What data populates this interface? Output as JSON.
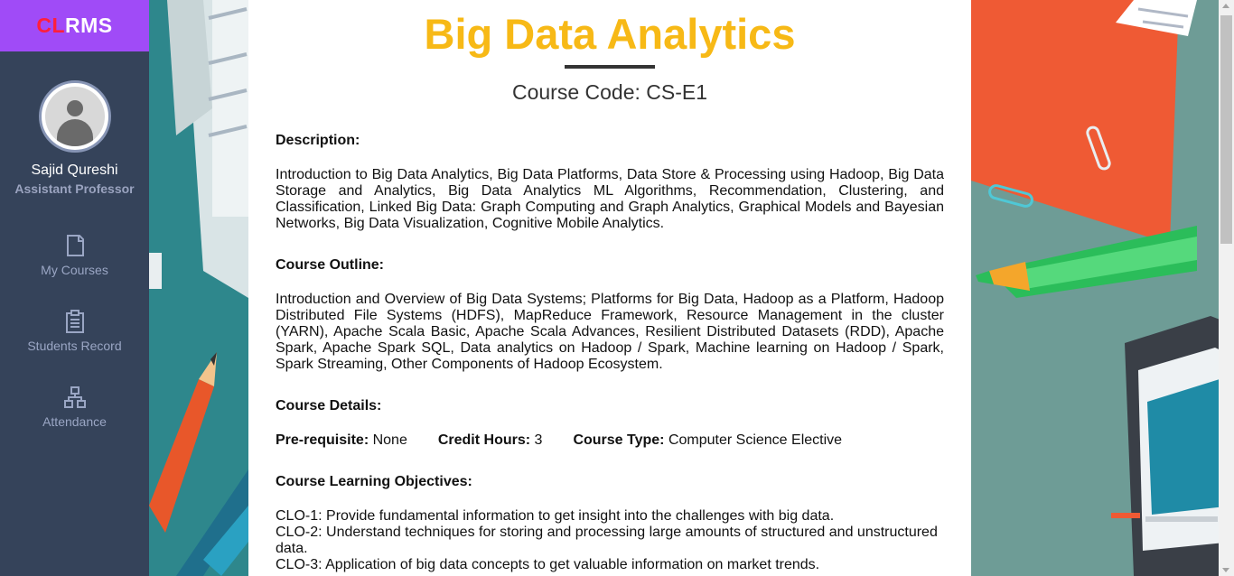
{
  "brand": {
    "part1": "CL",
    "part2": "RMS"
  },
  "user": {
    "name": "Sajid Qureshi",
    "role": "Assistant Professor"
  },
  "nav": [
    {
      "label": "My Courses",
      "icon": "document-icon"
    },
    {
      "label": "Students Record",
      "icon": "clipboard-icon"
    },
    {
      "label": "Attendance",
      "icon": "hierarchy-icon"
    }
  ],
  "course": {
    "title": "Big Data Analytics",
    "code_label": "Course Code:",
    "code": "CS-E1",
    "description_heading": "Description:",
    "description": "Introduction to Big Data Analytics, Big Data Platforms, Data Store & Processing using Hadoop, Big Data Storage and Analytics, Big Data Analytics ML Algorithms, Recommendation, Clustering, and Classification, Linked Big Data: Graph Computing and Graph Analytics, Graphical Models and Bayesian Networks, Big Data Visualization, Cognitive Mobile Analytics.",
    "outline_heading": "Course Outline:",
    "outline": "Introduction and Overview of Big Data Systems; Platforms for Big Data, Hadoop as a Platform, Hadoop Distributed File Systems (HDFS), MapReduce Framework, Resource Management in the cluster (YARN), Apache Scala Basic, Apache Scala Advances, Resilient Distributed Datasets (RDD), Apache Spark, Apache Spark SQL, Data analytics on Hadoop / Spark, Machine learning on Hadoop / Spark, Spark Streaming, Other Components of Hadoop Ecosystem.",
    "details_heading": "Course Details:",
    "prereq_label": "Pre-requisite:",
    "prereq": "None",
    "credit_label": "Credit Hours:",
    "credit": "3",
    "type_label": "Course Type:",
    "type": "Computer Science Elective",
    "objectives_heading": "Course Learning Objectives:",
    "objectives": [
      "CLO-1: Provide fundamental information to get insight into the challenges with big data.",
      "CLO-2: Understand techniques for storing and processing large amounts of structured and unstructured data.",
      "CLO-3: Application of big data concepts to get valuable information on market trends."
    ]
  },
  "colors": {
    "brand_bg": "#a04bf7",
    "sidebar_bg": "#35435a",
    "title": "#f7b916",
    "brand_cl": "#ff1f3d"
  }
}
